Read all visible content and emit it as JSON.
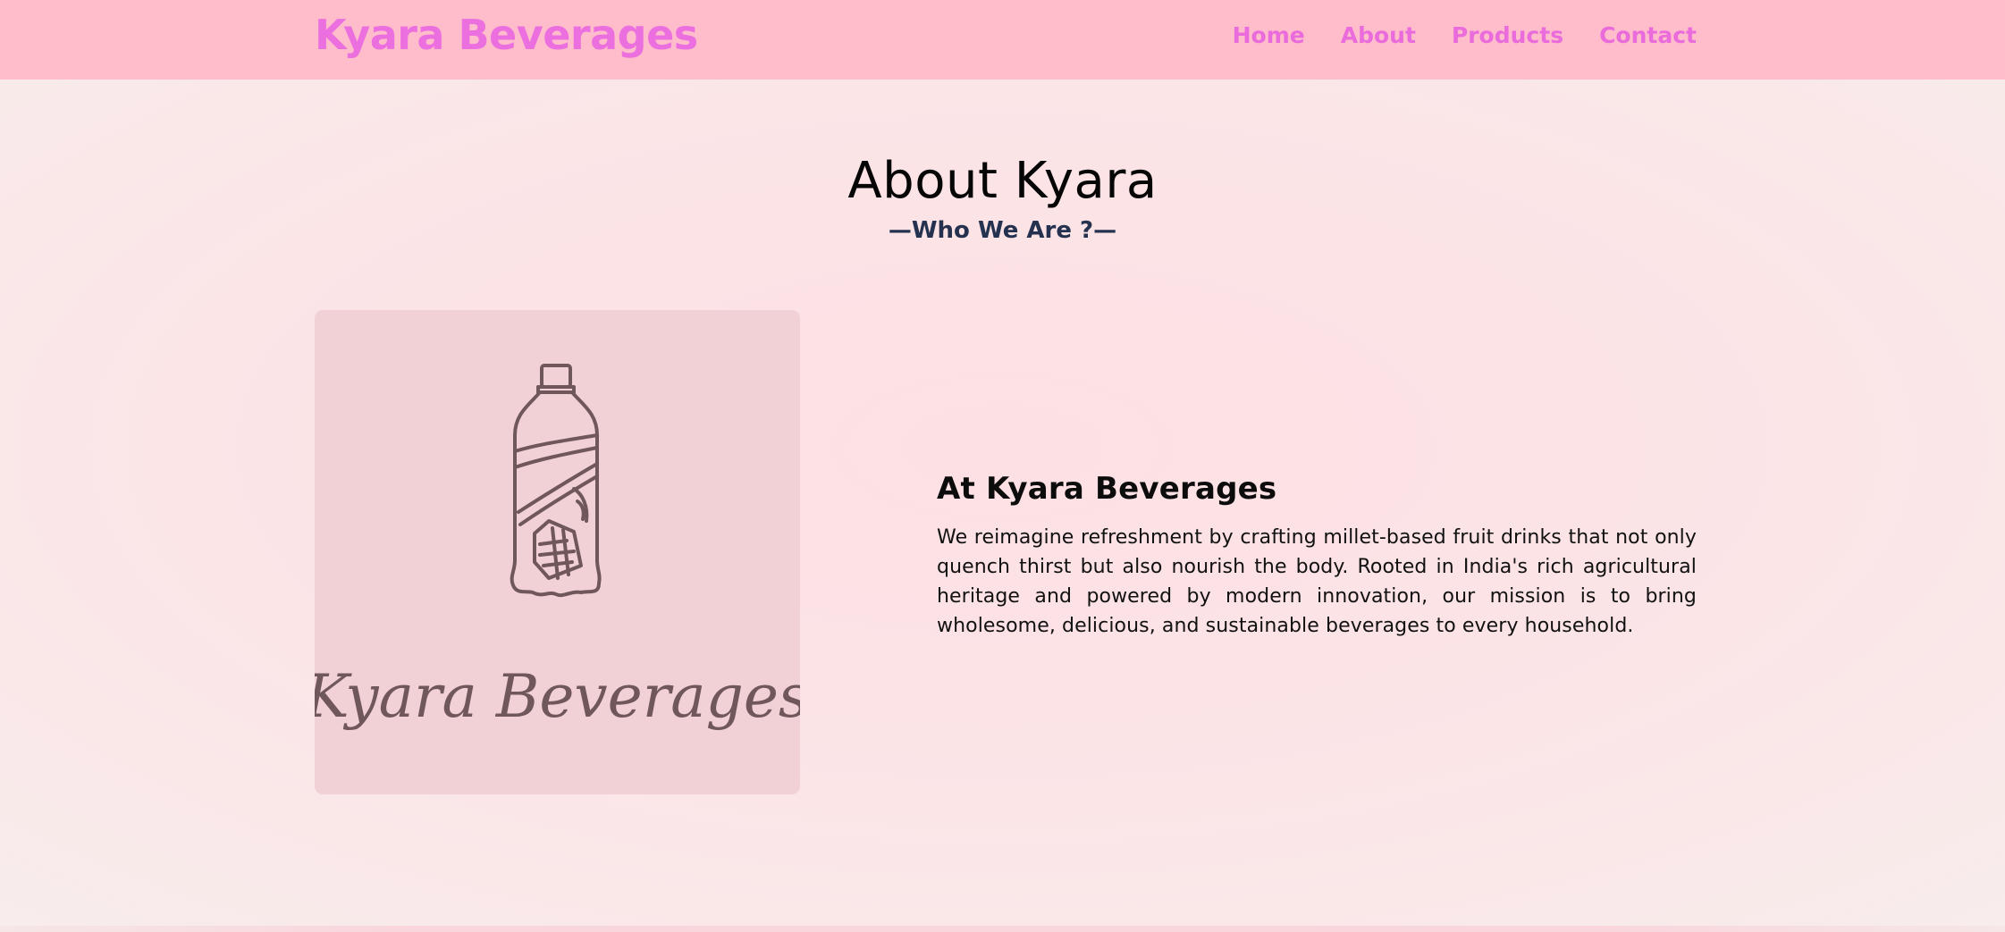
{
  "header": {
    "brand": "Kyara Beverages",
    "nav": [
      {
        "label": "Home"
      },
      {
        "label": "About"
      },
      {
        "label": "Products"
      },
      {
        "label": "Contact"
      }
    ]
  },
  "about": {
    "title": "About Kyara",
    "subtitle": "—Who We Are ?—",
    "image": {
      "icon": "bottle-logo-icon",
      "script_text": "Kyara Beverages"
    },
    "heading": "At Kyara Beverages",
    "body": "We reimagine refreshment by crafting millet-based fruit drinks that not only quench thirst but also nourish the body. Rooted in India's rich agricultural heritage and powered by modern innovation, our mission is to bring wholesome, delicious, and sustainable beverages to every household."
  },
  "colors": {
    "navbar_bg": "#ffbcca",
    "brand_pink": "#ec6fe0",
    "subtitle_navy": "#24324f",
    "card_bg": "#f1d0d6",
    "logo_ink": "#6f575c"
  }
}
